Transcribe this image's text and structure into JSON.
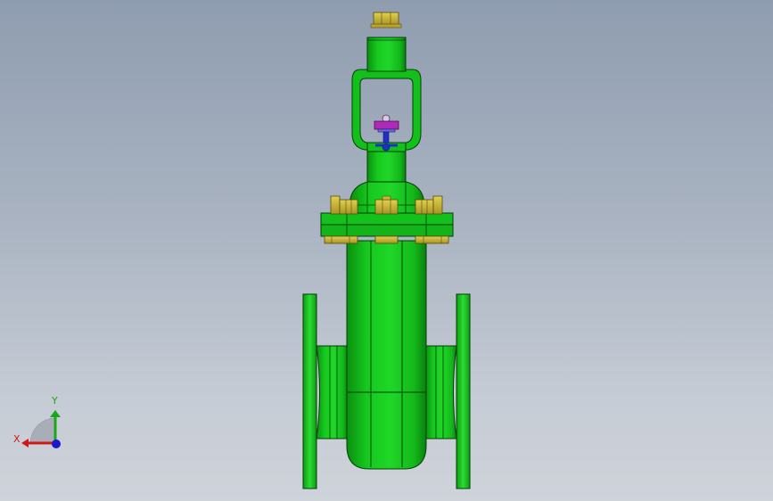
{
  "viewport": {
    "model": "gate-valve",
    "view_orientation": "front",
    "colors": {
      "body": "#12c41a",
      "body_dark": "#0a8a10",
      "body_light": "#3fe646",
      "outline": "#063d08",
      "fastener": "#c8b43a",
      "fastener_dark": "#7a6a14",
      "stem_nut": "#b02ab8",
      "stem": "#2030c0"
    }
  },
  "triad": {
    "x_label": "X",
    "y_label": "Y",
    "x_color": "#d01818",
    "y_color": "#18a818",
    "z_color": "#1818d0"
  }
}
